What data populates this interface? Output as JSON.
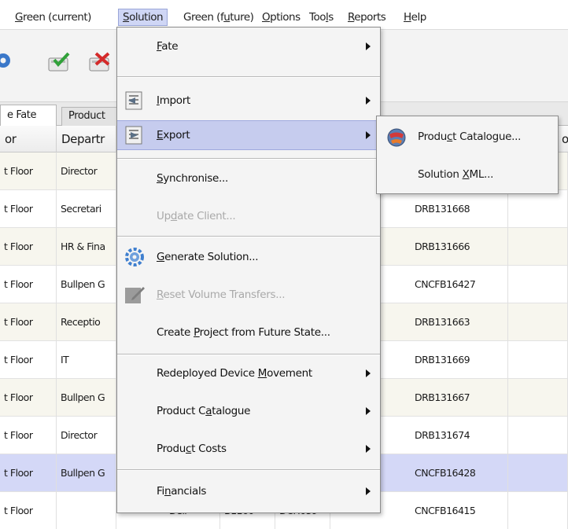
{
  "menubar": {
    "items": [
      {
        "pre": "",
        "key": "G",
        "post": "reen (current)"
      },
      {
        "pre": "",
        "key": "S",
        "post": "olution"
      },
      {
        "pre": "Green (f",
        "key": "u",
        "post": "ture)"
      },
      {
        "pre": "",
        "key": "O",
        "post": "ptions"
      },
      {
        "pre": "Too",
        "key": "l",
        "post": "s"
      },
      {
        "pre": "",
        "key": "R",
        "post": "eports"
      },
      {
        "pre": "",
        "key": "H",
        "post": "elp"
      }
    ]
  },
  "toolbar": {
    "icons": [
      "gear-icon",
      "check-icon",
      "delete-icon"
    ]
  },
  "tabs": [
    {
      "label": "e Fate"
    },
    {
      "label": "Product"
    }
  ],
  "grid": {
    "headers": [
      "or",
      "Departr",
      "or"
    ],
    "rows": [
      {
        "floor": "t Floor",
        "dept": "Director",
        "c3": "",
        "c4": "",
        "c5": "",
        "serial": ""
      },
      {
        "floor": "t Floor",
        "dept": "Secretari",
        "c3": "",
        "c4": "",
        "c5": "",
        "serial": "DRB131668"
      },
      {
        "floor": "t Floor",
        "dept": "HR & Fina",
        "c3": "",
        "c4": "",
        "c5": "",
        "serial": "DRB131666"
      },
      {
        "floor": "t Floor",
        "dept": "Bullpen G",
        "c3": "",
        "c4": "",
        "c5": "",
        "serial": "CNCFB16427"
      },
      {
        "floor": "t Floor",
        "dept": "Receptio",
        "c3": "",
        "c4": "",
        "c5": "",
        "serial": "DRB131663"
      },
      {
        "floor": "t Floor",
        "dept": "IT",
        "c3": "",
        "c4": "",
        "c5": "",
        "serial": "DRB131669"
      },
      {
        "floor": "t Floor",
        "dept": "Bullpen G",
        "c3": "",
        "c4": "",
        "c5": "",
        "serial": "DRB131667"
      },
      {
        "floor": "t Floor",
        "dept": "Director",
        "c3": "",
        "c4": "",
        "c5": "",
        "serial": "DRB131674"
      },
      {
        "floor": "t Floor",
        "dept": "Bullpen G",
        "c3": "",
        "c4": "",
        "c5": "",
        "serial": "CNCFB16428"
      },
      {
        "floor": "t Floor",
        "dept": "",
        "c3": "Dell",
        "c4": "B1160",
        "c5": "DCH039",
        "serial": "CNCFB16415"
      }
    ]
  },
  "solution_menu": {
    "items": [
      {
        "pre": "",
        "key": "F",
        "post": "ate",
        "submenu": true,
        "disabled": false,
        "icon": ""
      },
      {
        "pre": "",
        "key": "I",
        "post": "mport",
        "submenu": true,
        "disabled": false,
        "icon": "import-icon"
      },
      {
        "pre": "",
        "key": "E",
        "post": "xport",
        "submenu": true,
        "disabled": false,
        "icon": "export-icon"
      },
      {
        "pre": "",
        "key": "S",
        "post": "ynchronise...",
        "submenu": false,
        "disabled": false,
        "icon": ""
      },
      {
        "pre": "Up",
        "key": "d",
        "post": "ate Client...",
        "submenu": false,
        "disabled": true,
        "icon": ""
      },
      {
        "pre": "",
        "key": "G",
        "post": "enerate Solution...",
        "submenu": false,
        "disabled": false,
        "icon": "generate-gears-icon"
      },
      {
        "pre": "",
        "key": "R",
        "post": "eset Volume Transfers...",
        "submenu": false,
        "disabled": true,
        "icon": "reset-pad-icon"
      },
      {
        "pre": "Create ",
        "key": "P",
        "post": "roject from Future State...",
        "submenu": false,
        "disabled": false,
        "icon": ""
      },
      {
        "pre": "Redeployed Device ",
        "key": "M",
        "post": "ovement",
        "submenu": true,
        "disabled": false,
        "icon": ""
      },
      {
        "pre": "Product C",
        "key": "a",
        "post": "talogue",
        "submenu": true,
        "disabled": false,
        "icon": ""
      },
      {
        "pre": "Produ",
        "key": "c",
        "post": "t Costs",
        "submenu": true,
        "disabled": false,
        "icon": ""
      },
      {
        "pre": "Fi",
        "key": "n",
        "post": "ancials",
        "submenu": true,
        "disabled": false,
        "icon": ""
      }
    ]
  },
  "export_submenu": {
    "items": [
      {
        "pre": "Produ",
        "key": "c",
        "post": "t Catalogue...",
        "icon": "catalogue-globe-icon"
      },
      {
        "pre": "Solution ",
        "key": "X",
        "post": "ML...",
        "icon": ""
      }
    ]
  },
  "colors": {
    "highlight": "#c6ccee",
    "selected_row": "#d4d8f7",
    "alt_row": "#f7f6ee",
    "menu_bg": "#f4f4f4"
  }
}
